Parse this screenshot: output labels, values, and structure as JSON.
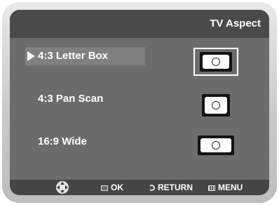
{
  "header": {
    "title": "TV Aspect"
  },
  "menu": {
    "items": [
      {
        "label": "4:3 Letter Box",
        "selected": true,
        "icon": "tv-letterbox-icon"
      },
      {
        "label": "4:3 Pan Scan",
        "selected": false,
        "icon": "tv-panscan-icon"
      },
      {
        "label": "16:9 Wide",
        "selected": false,
        "icon": "tv-wide-icon"
      }
    ]
  },
  "footer": {
    "nav_icon": "dpad-icon",
    "ok_label": "OK",
    "return_label": "RETURN",
    "menu_label": "MENU"
  },
  "colors": {
    "screen_bg": "#6c6c6c",
    "header_bg": "#4a4a4a",
    "footer_bg": "#454545",
    "highlight_bg": "#808080",
    "text": "#ffffff"
  }
}
